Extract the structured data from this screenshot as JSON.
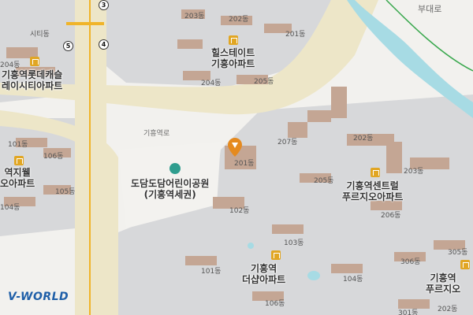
{
  "map": {
    "buildings": [
      "203동",
      "202동",
      "201동",
      "205동",
      "204동",
      "101동",
      "106동",
      "105동",
      "104동",
      "201동",
      "207동",
      "202동",
      "203동",
      "205동",
      "206동",
      "102동",
      "103동",
      "101동",
      "104동",
      "106동",
      "306동",
      "305동",
      "301동",
      "202동",
      "204동"
    ],
    "complexes": [
      {
        "icon": "apartment-icon",
        "lines": [
          "힐스테이트",
          "기흥아파트"
        ]
      },
      {
        "icon": "apartment-icon",
        "lines": [
          "기흥역롯데캐슬",
          "레이시티아파트"
        ]
      },
      {
        "icon": "apartment-icon",
        "lines": [
          "역지웰",
          "오아파트"
        ]
      },
      {
        "icon": "apartment-icon",
        "lines": [
          "기흥역센트럴",
          "푸르지오아파트"
        ]
      },
      {
        "icon": "apartment-icon",
        "lines": [
          "기흥역",
          "더샵아파트"
        ]
      },
      {
        "icon": "apartment-icon",
        "lines": [
          "기흥역",
          "푸르지오"
        ]
      }
    ],
    "park": {
      "icon": "park-icon",
      "lines": [
        "도담도담어린이공원",
        "(기흥역세권)"
      ]
    },
    "roads": {
      "main": "기흥역로",
      "topright": "부대로"
    },
    "places": {
      "citidong": "시티동"
    },
    "exits": [
      "3",
      "5",
      "4"
    ],
    "poi_marker": "map-pin-icon",
    "logo": "V-WORLD",
    "colors": {
      "road": "#e9e2c8",
      "block": "#d8d9da",
      "building": "#c7a893",
      "park": "#f2f1ee",
      "rail": "#f0b429",
      "water": "#77c3d4"
    }
  }
}
